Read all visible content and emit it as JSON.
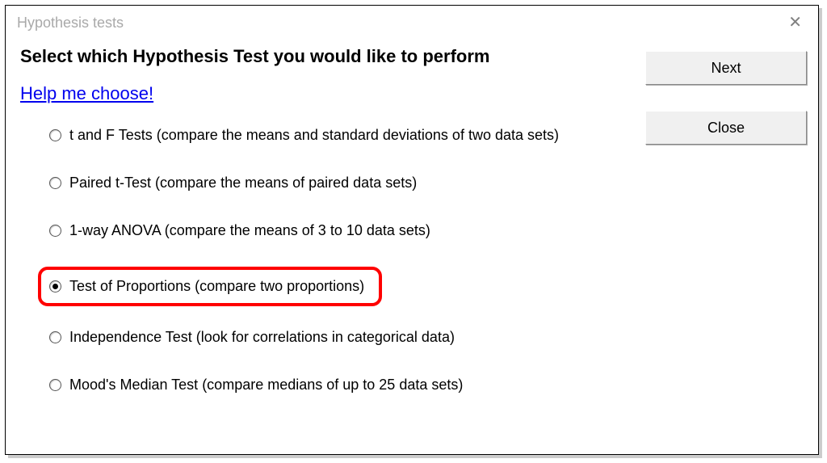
{
  "titlebar": {
    "title": "Hypothesis tests"
  },
  "heading": "Select which Hypothesis Test you would like to perform",
  "help_link": "Help me choose!",
  "options": [
    {
      "label": "t and F Tests (compare the means and standard deviations of two data sets)",
      "selected": false,
      "highlight": false
    },
    {
      "label": "Paired t-Test (compare the means of paired data sets)",
      "selected": false,
      "highlight": false
    },
    {
      "label": "1-way ANOVA (compare the means of 3 to 10 data sets)",
      "selected": false,
      "highlight": false
    },
    {
      "label": "Test of Proportions (compare two proportions)",
      "selected": true,
      "highlight": true
    },
    {
      "label": "Independence Test (look for correlations in categorical data)",
      "selected": false,
      "highlight": false
    },
    {
      "label": "Mood's Median Test (compare medians of up to 25 data sets)",
      "selected": false,
      "highlight": false
    }
  ],
  "buttons": {
    "next": "Next",
    "close": "Close"
  }
}
